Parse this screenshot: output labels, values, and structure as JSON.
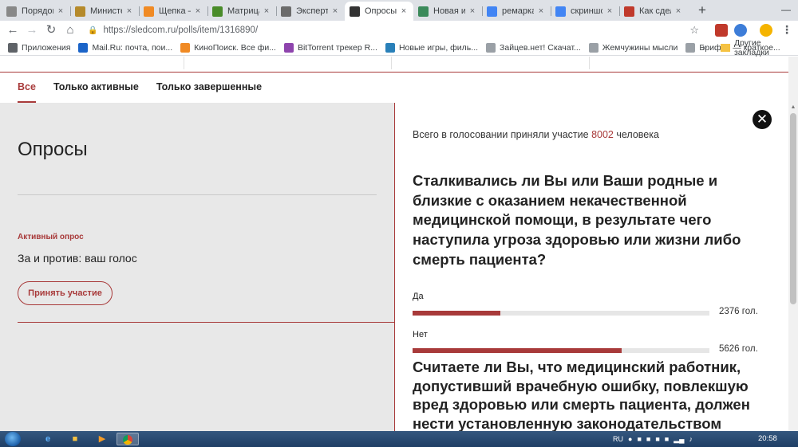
{
  "browser": {
    "tabs": [
      {
        "title": "Порядок",
        "icon": "doc",
        "color": "#888888",
        "active": false
      },
      {
        "title": "Министер",
        "icon": "emblem",
        "color": "#b58a2b",
        "active": false
      },
      {
        "title": "Щепка —",
        "icon": "orange-circle",
        "color": "#f08a24",
        "active": false
      },
      {
        "title": "Матрица",
        "icon": "matrix",
        "color": "#4a8c2a",
        "active": false
      },
      {
        "title": "Эксперты",
        "icon": "handshake",
        "color": "#6b6b6b",
        "active": false
      },
      {
        "title": "Опросы",
        "icon": "sledcom",
        "color": "#333333",
        "active": true
      },
      {
        "title": "Новая ин",
        "icon": "circle",
        "color": "#3b8a5a",
        "active": false
      },
      {
        "title": "ремарка",
        "icon": "google",
        "color": "#4285f4",
        "active": false
      },
      {
        "title": "скриншо",
        "icon": "google",
        "color": "#4285f4",
        "active": false
      },
      {
        "title": "Как сдела",
        "icon": "bookmark",
        "color": "#c0392b",
        "active": false
      }
    ],
    "tab_close_glyph": "×",
    "new_tab_glyph": "+",
    "url": "https://sledcom.ru/polls/item/1316890/",
    "bookmarks": [
      {
        "label": "Приложения",
        "color": "#5f6368"
      },
      {
        "label": "Mail.Ru: почта, пои...",
        "color": "#1b64c8"
      },
      {
        "label": "КиноПоиск. Все фи...",
        "color": "#f08a24"
      },
      {
        "label": "BitTorrent трекер R...",
        "color": "#8e44ad"
      },
      {
        "label": "Новые игры, филь...",
        "color": "#2980b9"
      },
      {
        "label": "Зайцев.нет! Скачат...",
        "color": "#9aa0a6"
      },
      {
        "label": "Жемчужины мысли",
        "color": "#9aa0a6"
      },
      {
        "label": "Брифли — краткое...",
        "color": "#9aa0a6"
      }
    ],
    "bookmarks_more": "»",
    "other_bookmarks": "Другие закладки"
  },
  "page": {
    "filters": [
      "Все",
      "Только активные",
      "Только завершенные"
    ],
    "active_filter_index": 0,
    "section_title": "Опросы",
    "active_poll_label": "Активный опрос",
    "active_poll_title": "За и против: ваш голос",
    "participate_button": "Принять участие",
    "accent_color": "#a83a3a"
  },
  "poll": {
    "total_prefix": "Всего в голосовании приняли участие",
    "total_count": "8002",
    "total_suffix": "человека",
    "question_1": "Сталкивались ли Вы или Ваши родные и близкие с оказанием некачественной медицинской помощи, в результате чего наступила угроза здоровью или жизни либо смерть пациента?",
    "answers": [
      {
        "label": "Да",
        "votes_text": "2376 гол.",
        "share": 0.297
      },
      {
        "label": "Нет",
        "votes_text": "5626 гол.",
        "share": 0.703
      }
    ],
    "question_2": "Считаете ли Вы, что медицинский работник, допустивший врачебную ошибку, повлекшую вред здоровью или смерть пациента, должен нести установленную законодательством"
  },
  "taskbar": {
    "language": "RU",
    "time": "20:58"
  }
}
